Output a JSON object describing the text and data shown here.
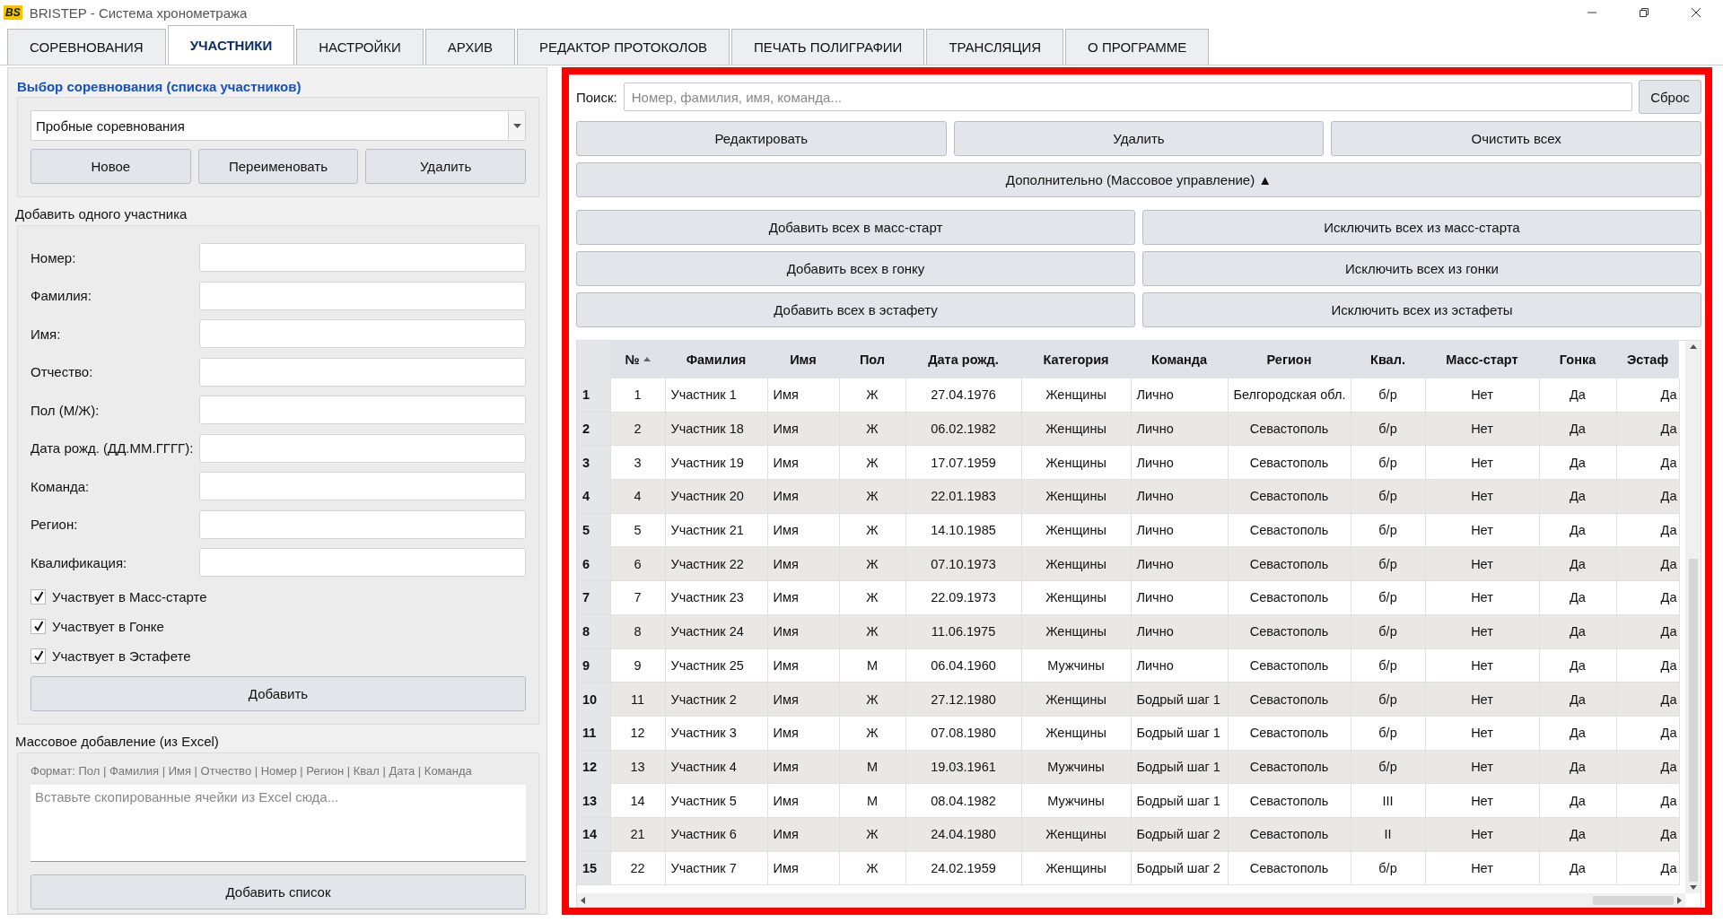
{
  "window": {
    "logo": "BS",
    "title": "BRISTEP - Система хронометража"
  },
  "tabs": [
    {
      "label": "СОРЕВНОВАНИЯ",
      "selected": false
    },
    {
      "label": "УЧАСТНИКИ",
      "selected": true
    },
    {
      "label": "НАСТРОЙКИ",
      "selected": false
    },
    {
      "label": "АРХИВ",
      "selected": false
    },
    {
      "label": "РЕДАКТОР ПРОТОКОЛОВ",
      "selected": false
    },
    {
      "label": "ПЕЧАТЬ ПОЛИГРАФИИ",
      "selected": false
    },
    {
      "label": "ТРАНСЛЯЦИЯ",
      "selected": false
    },
    {
      "label": "О ПРОГРАММЕ",
      "selected": false
    }
  ],
  "competition_select": {
    "heading": "Выбор соревнования (списка участников)",
    "value": "Пробные соревнования",
    "buttons": [
      "Новое",
      "Переименовать",
      "Удалить"
    ]
  },
  "add_one": {
    "heading": "Добавить одного участника",
    "fields": [
      {
        "label": "Номер:"
      },
      {
        "label": "Фамилия:"
      },
      {
        "label": "Имя:"
      },
      {
        "label": "Отчество:"
      },
      {
        "label": "Пол (М/Ж):"
      },
      {
        "label": "Дата рожд. (ДД.ММ.ГГГГ):"
      },
      {
        "label": "Команда:"
      },
      {
        "label": "Регион:"
      },
      {
        "label": "Квалификация:"
      }
    ],
    "checkboxes": [
      {
        "label": "Участвует в Масс-старте",
        "checked": true
      },
      {
        "label": "Участвует в Гонке",
        "checked": true
      },
      {
        "label": "Участвует в Эстафете",
        "checked": true
      }
    ],
    "button": "Добавить"
  },
  "bulk_add": {
    "heading": "Массовое добавление (из Excel)",
    "format": "Формат: Пол | Фамилия | Имя | Отчество | Номер | Регион | Квал | Дата | Команда",
    "placeholder": "Вставьте скопированные ячейки из Excel сюда...",
    "button": "Добавить список"
  },
  "search": {
    "label": "Поиск:",
    "placeholder": "Номер, фамилия, имя, команда...",
    "reset": "Сброс"
  },
  "actions": [
    "Редактировать",
    "Удалить",
    "Очистить всех"
  ],
  "more": {
    "label": "Дополнительно (Массовое управление) ▲"
  },
  "mass_buttons": [
    "Добавить всех в масс-старт",
    "Исключить всех из масс-старта",
    "Добавить всех в гонку",
    "Исключить всех из гонки",
    "Добавить всех в эстафету",
    "Исключить всех из эстафеты"
  ],
  "table": {
    "columns": [
      {
        "label": "№",
        "sorted": true
      },
      {
        "label": "Фамилия",
        "sorted": false
      },
      {
        "label": "Имя",
        "sorted": false
      },
      {
        "label": "Пол",
        "sorted": false
      },
      {
        "label": "Дата рожд.",
        "sorted": false
      },
      {
        "label": "Категория",
        "sorted": false
      },
      {
        "label": "Команда",
        "sorted": false
      },
      {
        "label": "Регион",
        "sorted": false
      },
      {
        "label": "Квал.",
        "sorted": false
      },
      {
        "label": "Масс-старт",
        "sorted": false
      },
      {
        "label": "Гонка",
        "sorted": false
      },
      {
        "label": "Эстаф",
        "sorted": false
      }
    ],
    "rows": [
      {
        "index": "1",
        "cells": [
          "1",
          "Участник 1",
          "Имя",
          "Ж",
          "27.04.1976",
          "Женщины",
          "Лично",
          "Белгородская обл.",
          "б/р",
          "Нет",
          "Да",
          "Да"
        ]
      },
      {
        "index": "2",
        "cells": [
          "2",
          "Участник 18",
          "Имя",
          "Ж",
          "06.02.1982",
          "Женщины",
          "Лично",
          "Севастополь",
          "б/р",
          "Нет",
          "Да",
          "Да"
        ]
      },
      {
        "index": "3",
        "cells": [
          "3",
          "Участник 19",
          "Имя",
          "Ж",
          "17.07.1959",
          "Женщины",
          "Лично",
          "Севастополь",
          "б/р",
          "Нет",
          "Да",
          "Да"
        ]
      },
      {
        "index": "4",
        "cells": [
          "4",
          "Участник 20",
          "Имя",
          "Ж",
          "22.01.1983",
          "Женщины",
          "Лично",
          "Севастополь",
          "б/р",
          "Нет",
          "Да",
          "Да"
        ]
      },
      {
        "index": "5",
        "cells": [
          "5",
          "Участник 21",
          "Имя",
          "Ж",
          "14.10.1985",
          "Женщины",
          "Лично",
          "Севастополь",
          "б/р",
          "Нет",
          "Да",
          "Да"
        ]
      },
      {
        "index": "6",
        "cells": [
          "6",
          "Участник 22",
          "Имя",
          "Ж",
          "07.10.1973",
          "Женщины",
          "Лично",
          "Севастополь",
          "б/р",
          "Нет",
          "Да",
          "Да"
        ]
      },
      {
        "index": "7",
        "cells": [
          "7",
          "Участник 23",
          "Имя",
          "Ж",
          "22.09.1973",
          "Женщины",
          "Лично",
          "Севастополь",
          "б/р",
          "Нет",
          "Да",
          "Да"
        ]
      },
      {
        "index": "8",
        "cells": [
          "8",
          "Участник 24",
          "Имя",
          "Ж",
          "11.06.1975",
          "Женщины",
          "Лично",
          "Севастополь",
          "б/р",
          "Нет",
          "Да",
          "Да"
        ]
      },
      {
        "index": "9",
        "cells": [
          "9",
          "Участник 25",
          "Имя",
          "М",
          "06.04.1960",
          "Мужчины",
          "Лично",
          "Севастополь",
          "б/р",
          "Нет",
          "Да",
          "Да"
        ]
      },
      {
        "index": "10",
        "cells": [
          "11",
          "Участник 2",
          "Имя",
          "Ж",
          "27.12.1980",
          "Женщины",
          "Бодрый шаг 1",
          "Севастополь",
          "б/р",
          "Нет",
          "Да",
          "Да"
        ]
      },
      {
        "index": "11",
        "cells": [
          "12",
          "Участник 3",
          "Имя",
          "Ж",
          "07.08.1980",
          "Женщины",
          "Бодрый шаг 1",
          "Севастополь",
          "б/р",
          "Нет",
          "Да",
          "Да"
        ]
      },
      {
        "index": "12",
        "cells": [
          "13",
          "Участник 4",
          "Имя",
          "М",
          "19.03.1961",
          "Мужчины",
          "Бодрый шаг 1",
          "Севастополь",
          "б/р",
          "Нет",
          "Да",
          "Да"
        ]
      },
      {
        "index": "13",
        "cells": [
          "14",
          "Участник 5",
          "Имя",
          "М",
          "08.04.1982",
          "Мужчины",
          "Бодрый шаг 1",
          "Севастополь",
          "III",
          "Нет",
          "Да",
          "Да"
        ]
      },
      {
        "index": "14",
        "cells": [
          "21",
          "Участник 6",
          "Имя",
          "Ж",
          "24.04.1980",
          "Женщины",
          "Бодрый шаг 2",
          "Севастополь",
          "II",
          "Нет",
          "Да",
          "Да"
        ]
      },
      {
        "index": "15",
        "cells": [
          "22",
          "Участник 7",
          "Имя",
          "Ж",
          "24.02.1959",
          "Женщины",
          "Бодрый шаг 2",
          "Севастополь",
          "б/р",
          "Нет",
          "Да",
          "Да"
        ]
      }
    ]
  }
}
